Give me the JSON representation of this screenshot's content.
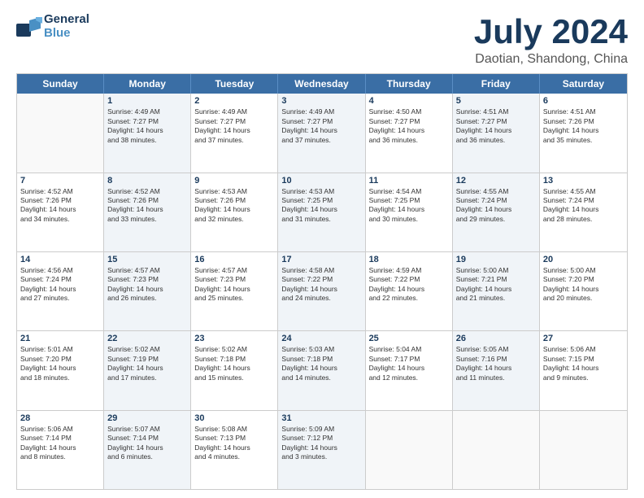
{
  "logo": {
    "line1": "General",
    "line2": "Blue"
  },
  "header": {
    "month_year": "July 2024",
    "location": "Daotian, Shandong, China"
  },
  "days_of_week": [
    "Sunday",
    "Monday",
    "Tuesday",
    "Wednesday",
    "Thursday",
    "Friday",
    "Saturday"
  ],
  "weeks": [
    [
      {
        "day": "",
        "sunrise": "",
        "sunset": "",
        "daylight": "",
        "shaded": false,
        "empty": true
      },
      {
        "day": "1",
        "sunrise": "Sunrise: 4:49 AM",
        "sunset": "Sunset: 7:27 PM",
        "daylight": "Daylight: 14 hours",
        "daylight2": "and 38 minutes.",
        "shaded": true,
        "empty": false
      },
      {
        "day": "2",
        "sunrise": "Sunrise: 4:49 AM",
        "sunset": "Sunset: 7:27 PM",
        "daylight": "Daylight: 14 hours",
        "daylight2": "and 37 minutes.",
        "shaded": false,
        "empty": false
      },
      {
        "day": "3",
        "sunrise": "Sunrise: 4:49 AM",
        "sunset": "Sunset: 7:27 PM",
        "daylight": "Daylight: 14 hours",
        "daylight2": "and 37 minutes.",
        "shaded": true,
        "empty": false
      },
      {
        "day": "4",
        "sunrise": "Sunrise: 4:50 AM",
        "sunset": "Sunset: 7:27 PM",
        "daylight": "Daylight: 14 hours",
        "daylight2": "and 36 minutes.",
        "shaded": false,
        "empty": false
      },
      {
        "day": "5",
        "sunrise": "Sunrise: 4:51 AM",
        "sunset": "Sunset: 7:27 PM",
        "daylight": "Daylight: 14 hours",
        "daylight2": "and 36 minutes.",
        "shaded": true,
        "empty": false
      },
      {
        "day": "6",
        "sunrise": "Sunrise: 4:51 AM",
        "sunset": "Sunset: 7:26 PM",
        "daylight": "Daylight: 14 hours",
        "daylight2": "and 35 minutes.",
        "shaded": false,
        "empty": false
      }
    ],
    [
      {
        "day": "7",
        "sunrise": "Sunrise: 4:52 AM",
        "sunset": "Sunset: 7:26 PM",
        "daylight": "Daylight: 14 hours",
        "daylight2": "and 34 minutes.",
        "shaded": false,
        "empty": false
      },
      {
        "day": "8",
        "sunrise": "Sunrise: 4:52 AM",
        "sunset": "Sunset: 7:26 PM",
        "daylight": "Daylight: 14 hours",
        "daylight2": "and 33 minutes.",
        "shaded": true,
        "empty": false
      },
      {
        "day": "9",
        "sunrise": "Sunrise: 4:53 AM",
        "sunset": "Sunset: 7:26 PM",
        "daylight": "Daylight: 14 hours",
        "daylight2": "and 32 minutes.",
        "shaded": false,
        "empty": false
      },
      {
        "day": "10",
        "sunrise": "Sunrise: 4:53 AM",
        "sunset": "Sunset: 7:25 PM",
        "daylight": "Daylight: 14 hours",
        "daylight2": "and 31 minutes.",
        "shaded": true,
        "empty": false
      },
      {
        "day": "11",
        "sunrise": "Sunrise: 4:54 AM",
        "sunset": "Sunset: 7:25 PM",
        "daylight": "Daylight: 14 hours",
        "daylight2": "and 30 minutes.",
        "shaded": false,
        "empty": false
      },
      {
        "day": "12",
        "sunrise": "Sunrise: 4:55 AM",
        "sunset": "Sunset: 7:24 PM",
        "daylight": "Daylight: 14 hours",
        "daylight2": "and 29 minutes.",
        "shaded": true,
        "empty": false
      },
      {
        "day": "13",
        "sunrise": "Sunrise: 4:55 AM",
        "sunset": "Sunset: 7:24 PM",
        "daylight": "Daylight: 14 hours",
        "daylight2": "and 28 minutes.",
        "shaded": false,
        "empty": false
      }
    ],
    [
      {
        "day": "14",
        "sunrise": "Sunrise: 4:56 AM",
        "sunset": "Sunset: 7:24 PM",
        "daylight": "Daylight: 14 hours",
        "daylight2": "and 27 minutes.",
        "shaded": false,
        "empty": false
      },
      {
        "day": "15",
        "sunrise": "Sunrise: 4:57 AM",
        "sunset": "Sunset: 7:23 PM",
        "daylight": "Daylight: 14 hours",
        "daylight2": "and 26 minutes.",
        "shaded": true,
        "empty": false
      },
      {
        "day": "16",
        "sunrise": "Sunrise: 4:57 AM",
        "sunset": "Sunset: 7:23 PM",
        "daylight": "Daylight: 14 hours",
        "daylight2": "and 25 minutes.",
        "shaded": false,
        "empty": false
      },
      {
        "day": "17",
        "sunrise": "Sunrise: 4:58 AM",
        "sunset": "Sunset: 7:22 PM",
        "daylight": "Daylight: 14 hours",
        "daylight2": "and 24 minutes.",
        "shaded": true,
        "empty": false
      },
      {
        "day": "18",
        "sunrise": "Sunrise: 4:59 AM",
        "sunset": "Sunset: 7:22 PM",
        "daylight": "Daylight: 14 hours",
        "daylight2": "and 22 minutes.",
        "shaded": false,
        "empty": false
      },
      {
        "day": "19",
        "sunrise": "Sunrise: 5:00 AM",
        "sunset": "Sunset: 7:21 PM",
        "daylight": "Daylight: 14 hours",
        "daylight2": "and 21 minutes.",
        "shaded": true,
        "empty": false
      },
      {
        "day": "20",
        "sunrise": "Sunrise: 5:00 AM",
        "sunset": "Sunset: 7:20 PM",
        "daylight": "Daylight: 14 hours",
        "daylight2": "and 20 minutes.",
        "shaded": false,
        "empty": false
      }
    ],
    [
      {
        "day": "21",
        "sunrise": "Sunrise: 5:01 AM",
        "sunset": "Sunset: 7:20 PM",
        "daylight": "Daylight: 14 hours",
        "daylight2": "and 18 minutes.",
        "shaded": false,
        "empty": false
      },
      {
        "day": "22",
        "sunrise": "Sunrise: 5:02 AM",
        "sunset": "Sunset: 7:19 PM",
        "daylight": "Daylight: 14 hours",
        "daylight2": "and 17 minutes.",
        "shaded": true,
        "empty": false
      },
      {
        "day": "23",
        "sunrise": "Sunrise: 5:02 AM",
        "sunset": "Sunset: 7:18 PM",
        "daylight": "Daylight: 14 hours",
        "daylight2": "and 15 minutes.",
        "shaded": false,
        "empty": false
      },
      {
        "day": "24",
        "sunrise": "Sunrise: 5:03 AM",
        "sunset": "Sunset: 7:18 PM",
        "daylight": "Daylight: 14 hours",
        "daylight2": "and 14 minutes.",
        "shaded": true,
        "empty": false
      },
      {
        "day": "25",
        "sunrise": "Sunrise: 5:04 AM",
        "sunset": "Sunset: 7:17 PM",
        "daylight": "Daylight: 14 hours",
        "daylight2": "and 12 minutes.",
        "shaded": false,
        "empty": false
      },
      {
        "day": "26",
        "sunrise": "Sunrise: 5:05 AM",
        "sunset": "Sunset: 7:16 PM",
        "daylight": "Daylight: 14 hours",
        "daylight2": "and 11 minutes.",
        "shaded": true,
        "empty": false
      },
      {
        "day": "27",
        "sunrise": "Sunrise: 5:06 AM",
        "sunset": "Sunset: 7:15 PM",
        "daylight": "Daylight: 14 hours",
        "daylight2": "and 9 minutes.",
        "shaded": false,
        "empty": false
      }
    ],
    [
      {
        "day": "28",
        "sunrise": "Sunrise: 5:06 AM",
        "sunset": "Sunset: 7:14 PM",
        "daylight": "Daylight: 14 hours",
        "daylight2": "and 8 minutes.",
        "shaded": false,
        "empty": false
      },
      {
        "day": "29",
        "sunrise": "Sunrise: 5:07 AM",
        "sunset": "Sunset: 7:14 PM",
        "daylight": "Daylight: 14 hours",
        "daylight2": "and 6 minutes.",
        "shaded": true,
        "empty": false
      },
      {
        "day": "30",
        "sunrise": "Sunrise: 5:08 AM",
        "sunset": "Sunset: 7:13 PM",
        "daylight": "Daylight: 14 hours",
        "daylight2": "and 4 minutes.",
        "shaded": false,
        "empty": false
      },
      {
        "day": "31",
        "sunrise": "Sunrise: 5:09 AM",
        "sunset": "Sunset: 7:12 PM",
        "daylight": "Daylight: 14 hours",
        "daylight2": "and 3 minutes.",
        "shaded": true,
        "empty": false
      },
      {
        "day": "",
        "sunrise": "",
        "sunset": "",
        "daylight": "",
        "daylight2": "",
        "shaded": false,
        "empty": true
      },
      {
        "day": "",
        "sunrise": "",
        "sunset": "",
        "daylight": "",
        "daylight2": "",
        "shaded": false,
        "empty": true
      },
      {
        "day": "",
        "sunrise": "",
        "sunset": "",
        "daylight": "",
        "daylight2": "",
        "shaded": false,
        "empty": true
      }
    ]
  ]
}
